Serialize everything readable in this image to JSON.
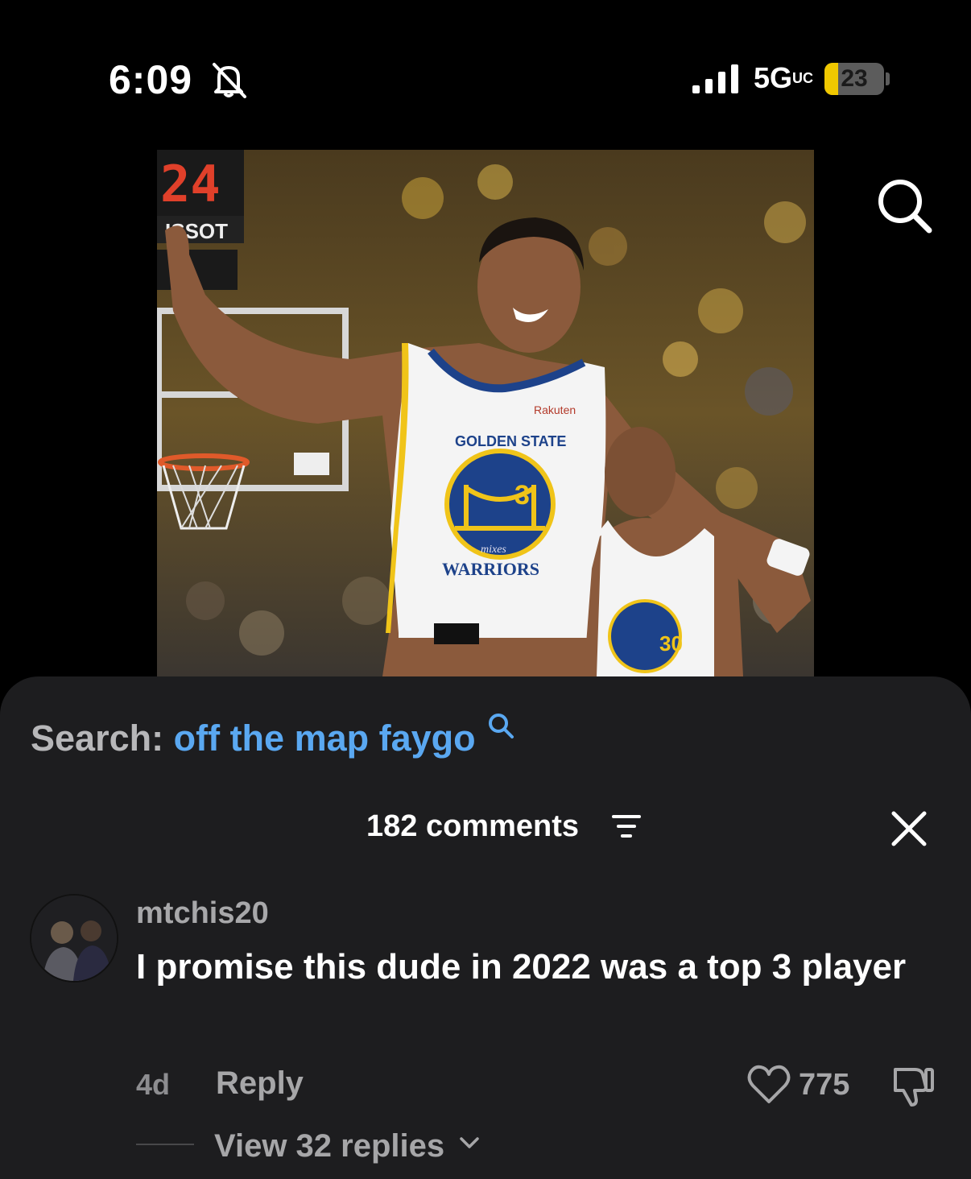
{
  "status_bar": {
    "time": "6:09",
    "network": "5G",
    "network_suffix": "UC",
    "battery_level": "23",
    "battery_fraction": 0.23,
    "battery_color": "#f0c800"
  },
  "video": {
    "scoreboard_top": "24",
    "scoreboard_brand": "ISSOT",
    "jersey_sponsor": "Rakuten",
    "jersey_team_top": "GOLDEN STATE",
    "jersey_team_bottom": "WARRIORS",
    "jersey_number_front": "3",
    "jersey_number_back": "30",
    "watermark": "mixes"
  },
  "sheet": {
    "search_label": "Search:",
    "search_term": "off the map faygo",
    "search_term_color": "#5aa8f1",
    "comments_count": "182 comments",
    "close_icon": "close-icon",
    "filter_icon": "filter-icon"
  },
  "comment": {
    "username": "mtchis20",
    "text": "I promise this dude in 2022 was a top 3 player",
    "time_ago": "4d",
    "reply_label": "Reply",
    "like_count": "775",
    "view_replies": "View 32 replies"
  }
}
